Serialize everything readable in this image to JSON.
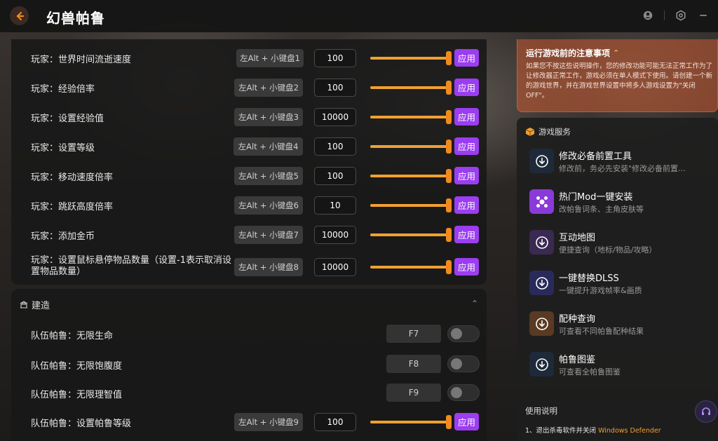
{
  "header": {
    "title": "幻兽帕鲁",
    "icons": [
      "back-arrow-icon",
      "user-circle-icon",
      "settings-icon",
      "minimize-icon"
    ]
  },
  "cheats": [
    {
      "label": "玩家：世界时间流逝速度",
      "hotkey": "左Alt + 小键盘1",
      "value": "100",
      "apply": "应用"
    },
    {
      "label": "玩家：经验倍率",
      "hotkey": "左Alt + 小键盘2",
      "value": "100",
      "apply": "应用"
    },
    {
      "label": "玩家：设置经验值",
      "hotkey": "左Alt + 小键盘3",
      "value": "10000",
      "apply": "应用"
    },
    {
      "label": "玩家：设置等级",
      "hotkey": "左Alt + 小键盘4",
      "value": "100",
      "apply": "应用"
    },
    {
      "label": "玩家：移动速度倍率",
      "hotkey": "左Alt + 小键盘5",
      "value": "100",
      "apply": "应用"
    },
    {
      "label": "玩家：跳跃高度倍率",
      "hotkey": "左Alt + 小键盘6",
      "value": "10",
      "apply": "应用"
    },
    {
      "label": "玩家：添加金币",
      "hotkey": "左Alt + 小键盘7",
      "value": "10000",
      "apply": "应用"
    },
    {
      "label": "玩家：设置鼠标悬停物品数量（设置-1表示取消设置物品数量）",
      "hotkey": "左Alt + 小键盘8",
      "value": "10000",
      "apply": "应用"
    }
  ],
  "build": {
    "title": "建造",
    "toggles": [
      {
        "label": "队伍帕鲁：无限生命",
        "hotkey": "F7",
        "on": false
      },
      {
        "label": "队伍帕鲁：无限饱腹度",
        "hotkey": "F8",
        "on": false
      },
      {
        "label": "队伍帕鲁：无限理智值",
        "hotkey": "F9",
        "on": false
      }
    ],
    "slider_row": {
      "label": "队伍帕鲁：设置帕鲁等级",
      "hotkey": "左Alt + 小键盘9",
      "value": "100",
      "apply": "应用"
    }
  },
  "notice": {
    "title": "运行游戏前的注意事项",
    "body": "如果您不按这些说明操作，您的修改功能可能无法正常工作为了让修改器正常工作，游戏必须在单人模式下使用。请创建一个新的游戏世界，并在游戏世界设置中将多人游戏设置为\"关闭OFF\"。"
  },
  "services": {
    "title": "游戏服务",
    "items": [
      {
        "title": "修改必备前置工具",
        "sub": "修改前，务必先安装\"修改必备前置...",
        "color": "#1e2a3a"
      },
      {
        "title": "热门Mod一键安装",
        "sub": "改帕鲁词条、主角皮肤等",
        "color": "#8a3ad8"
      },
      {
        "title": "互动地图",
        "sub": "便捷查询（地标/物品/攻略）",
        "color": "#3a2a52"
      },
      {
        "title": "一键替换DLSS",
        "sub": "一键提升游戏帧率&画质",
        "color": "#2a2a5a"
      },
      {
        "title": "配种查询",
        "sub": "可查看不同帕鲁配种结果",
        "color": "#5a3a22"
      },
      {
        "title": "帕鲁图鉴",
        "sub": "可查看全帕鲁图鉴",
        "color": "#1e2a3a"
      }
    ]
  },
  "usage": {
    "title": "使用说明",
    "line_prefix": "1、退出杀毒软件并关闭 ",
    "line_highlight": "Windows Defender"
  },
  "colors": {
    "accent": "#9b3df0",
    "slider": "#f0a030",
    "notice": "#c85a32"
  }
}
